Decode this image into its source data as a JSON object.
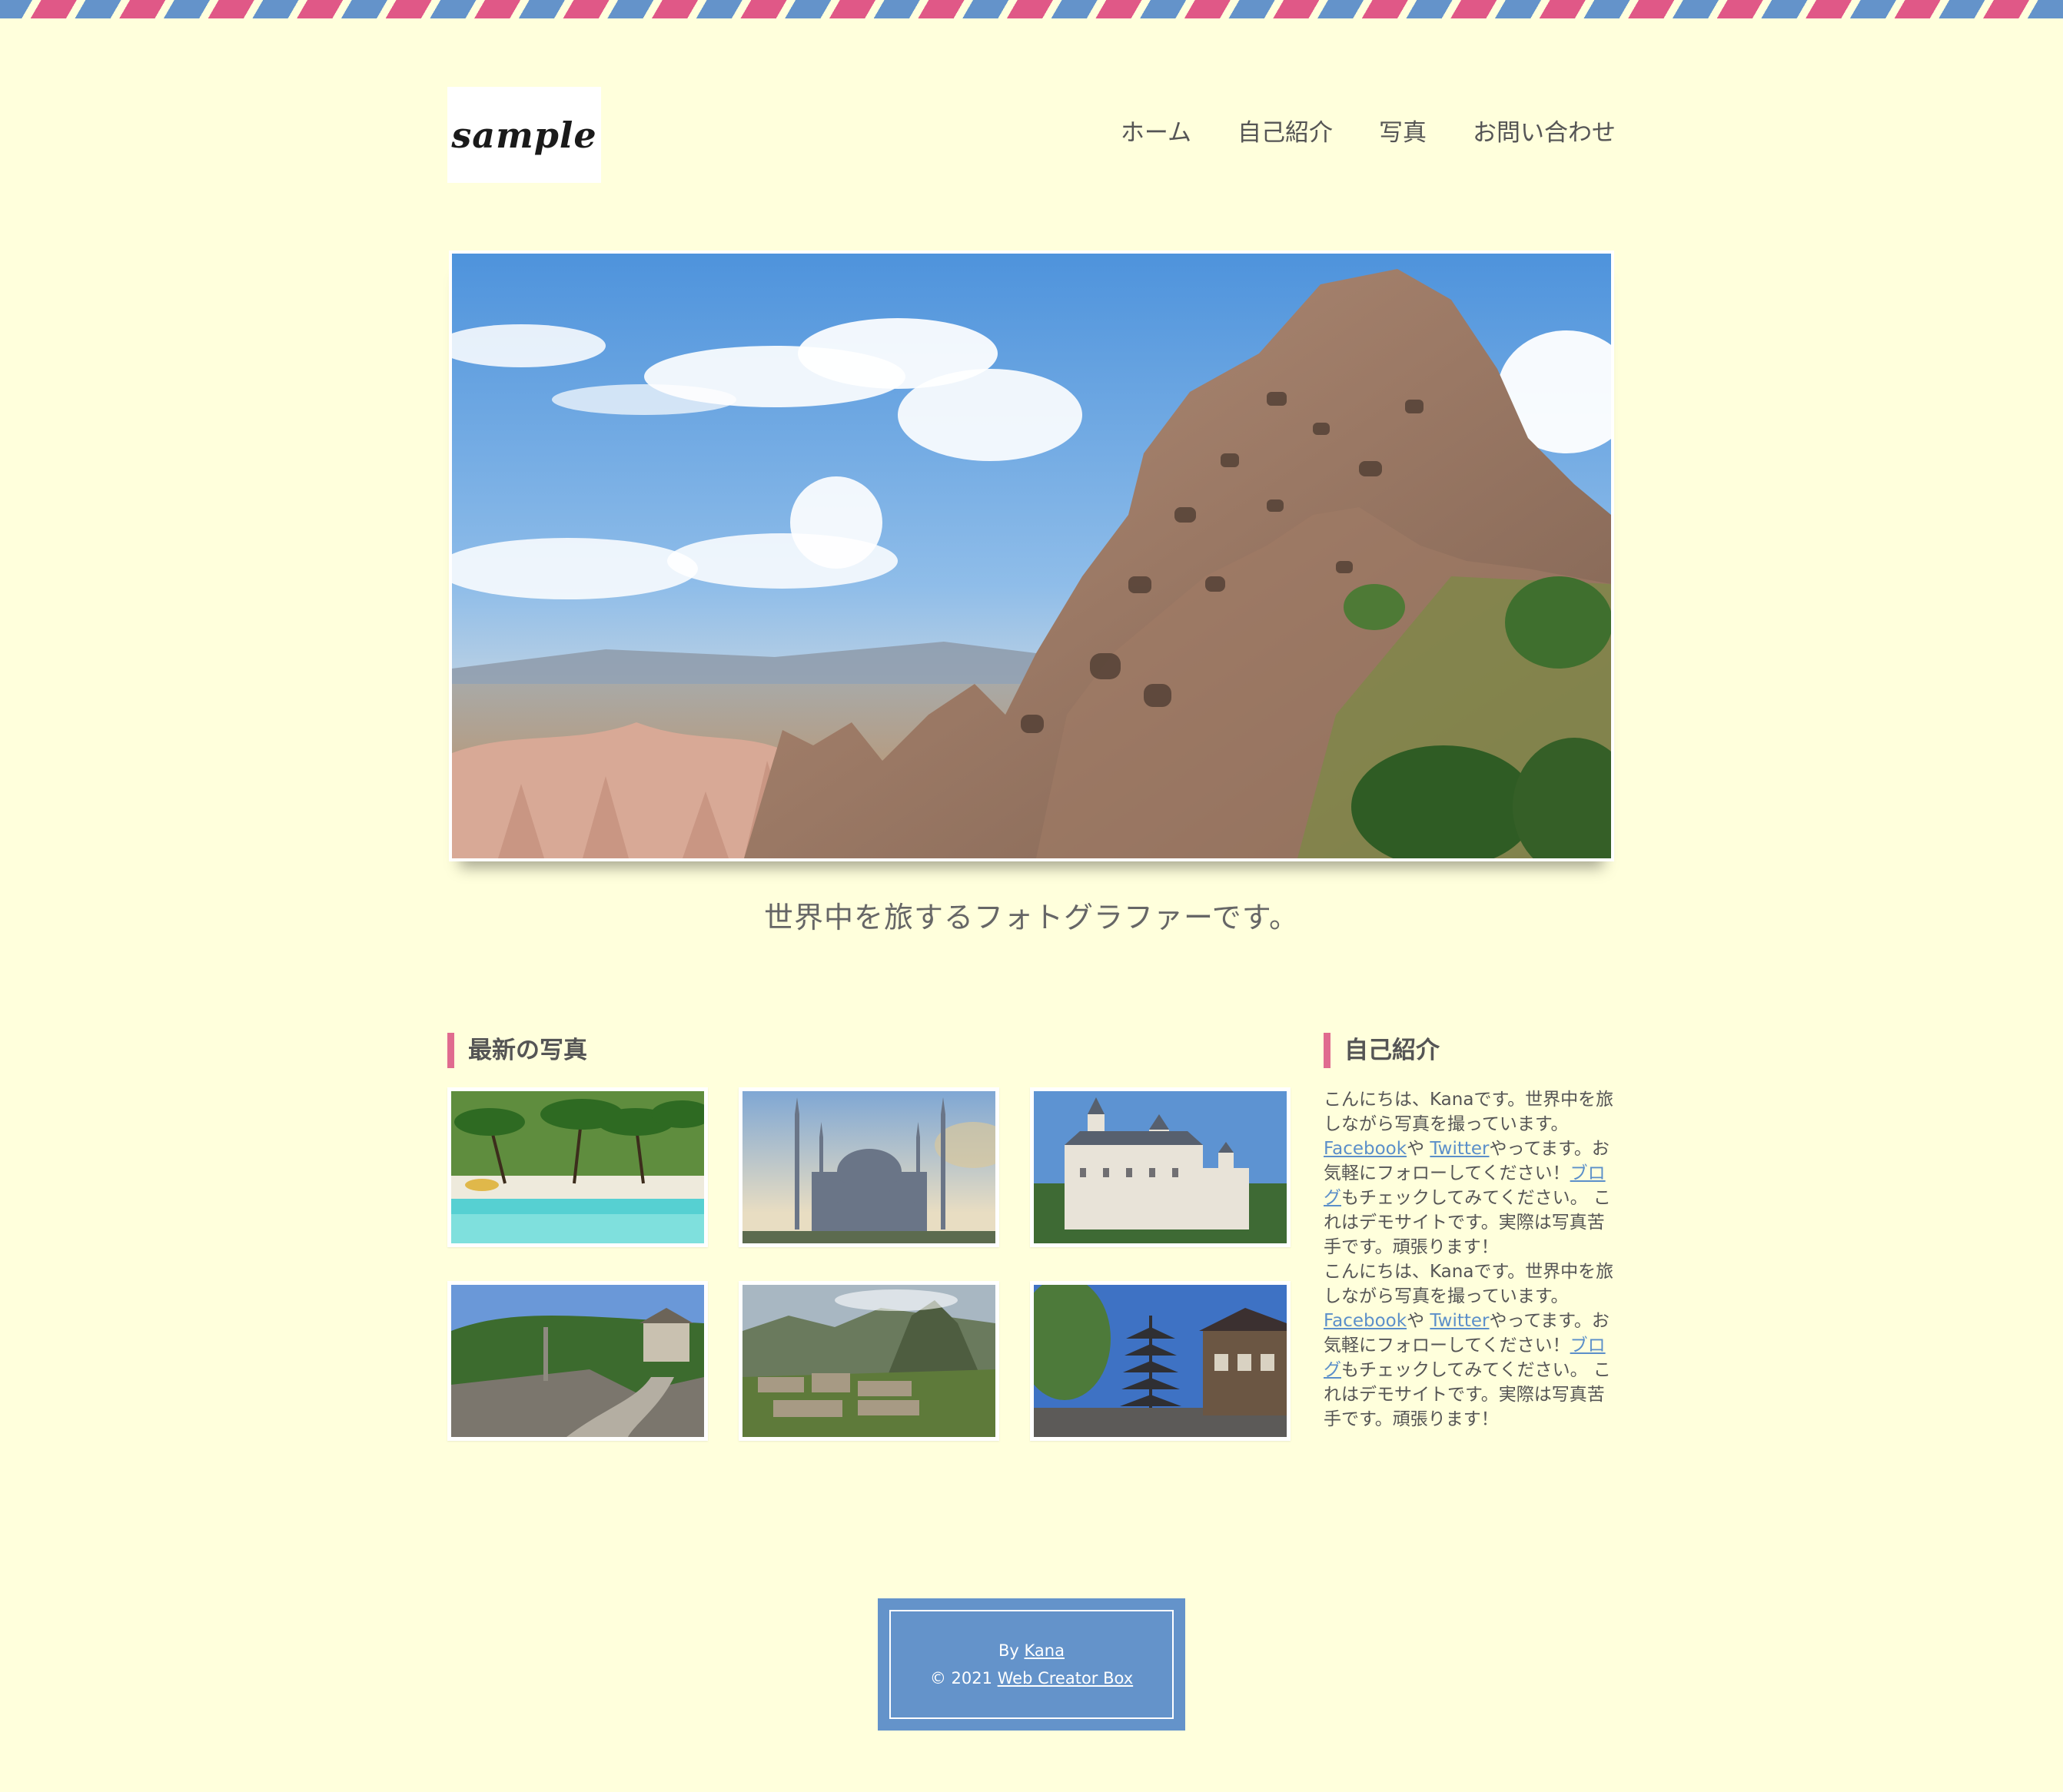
{
  "header": {
    "logo_text": "sample",
    "nav": [
      {
        "label": "ホーム"
      },
      {
        "label": "自己紹介"
      },
      {
        "label": "写真"
      },
      {
        "label": "お問い合わせ"
      }
    ]
  },
  "hero": {
    "tagline": "世界中を旅するフォトグラファーです。"
  },
  "photos": {
    "title": "最新の写真",
    "items": [
      {
        "subject": "palm-beach"
      },
      {
        "subject": "mosque"
      },
      {
        "subject": "castle"
      },
      {
        "subject": "great-wall"
      },
      {
        "subject": "machu-picchu"
      },
      {
        "subject": "pagoda"
      }
    ]
  },
  "about": {
    "title": "自己紹介",
    "paragraphs": [
      {
        "intro": "こんにちは、Kanaです。世界中を旅しながら写真を撮っています。",
        "facebook": "Facebook",
        "ya": "や ",
        "twitter": "Twitter",
        "yattemasu": "やってます。お気軽にフォローしてください！",
        "blog": "ブログ",
        "outro": "もチェックしてみてください。 これはデモサイトです。実際は写真苦手です。頑張ります！"
      },
      {
        "intro": "こんにちは、Kanaです。世界中を旅しながら写真を撮っています。",
        "facebook": "Facebook",
        "ya": "や ",
        "twitter": "Twitter",
        "yattemasu": "やってます。お気軽にフォローしてください！",
        "blog": "ブログ",
        "outro": "もチェックしてみてください。 これはデモサイトです。実際は写真苦手です。頑張ります！"
      }
    ]
  },
  "footer": {
    "by": "By ",
    "author": "Kana",
    "copyright": "© 2021 ",
    "company": "Web Creator Box"
  },
  "colors": {
    "background": "#ffffdc",
    "stripe_blue": "#6493ca",
    "stripe_pink": "#e05887",
    "accent": "#e06b8f",
    "link": "#5b8fc9",
    "footer": "#6493ca"
  }
}
